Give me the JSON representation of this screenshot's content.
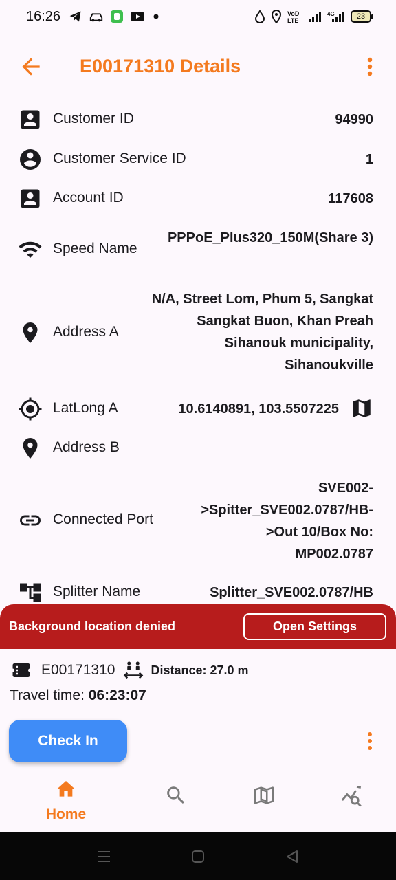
{
  "status_bar": {
    "time": "16:26",
    "battery": "23"
  },
  "app_bar": {
    "title": "E00171310 Details"
  },
  "details": [
    {
      "icon": "account-box-icon",
      "label": "Customer ID",
      "value": "94990"
    },
    {
      "icon": "account-circle-icon",
      "label": "Customer Service ID",
      "value": "1"
    },
    {
      "icon": "account-box-icon",
      "label": "Account ID",
      "value": "117608"
    },
    {
      "icon": "wifi-icon",
      "label": "Speed Name",
      "value": "PPPoE_Plus320_150M(Share 3)"
    },
    {
      "icon": "location-pin-icon",
      "label": "Address A",
      "value": "N/A, Street Lom, Phum 5, Sangkat Sangkat Buon, Khan Preah Sihanouk municipality, Sihanoukville"
    },
    {
      "icon": "gps-fixed-icon",
      "label": "LatLong A",
      "value": "10.6140891, 103.5507225"
    },
    {
      "icon": "location-pin-icon",
      "label": "Address B",
      "value": ""
    },
    {
      "icon": "link-icon",
      "label": "Connected Port",
      "value": "SVE002->Spitter_SVE002.0787/HB->Out 10/Box No: MP002.0787"
    },
    {
      "icon": "account-tree-icon",
      "label": "Splitter Name",
      "value": "Splitter_SVE002.0787/HB"
    }
  ],
  "banner": {
    "text": "Background location denied",
    "button": "Open Settings"
  },
  "info_panel": {
    "ticket_id": "E00171310",
    "distance": "Distance: 27.0 m",
    "travel_label": "Travel time: ",
    "travel_time": "06:23:07",
    "check_in": "Check In"
  },
  "bottom_nav": {
    "home": "Home"
  },
  "colors": {
    "accent": "#f47a1f",
    "banner": "#b71c1c",
    "primary_button": "#3f8cf7"
  }
}
